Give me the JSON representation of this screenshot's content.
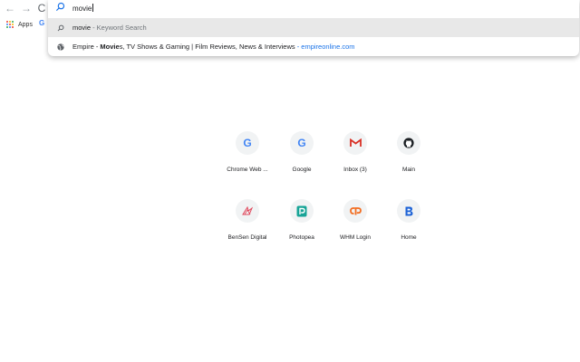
{
  "browser": {
    "nav": {
      "back": "←",
      "forward": "→",
      "reload": "C"
    },
    "bookmarks": {
      "apps_label": "Apps",
      "google_glyph": "G"
    }
  },
  "omnibox": {
    "query": "movie",
    "suggestions": [
      {
        "icon": "search-icon",
        "bold": "movie",
        "rest": " - Keyword Search",
        "url": ""
      },
      {
        "icon": "globe-icon",
        "pre": "Empire - ",
        "bold": "Movie",
        "rest": "s, TV Shows & Gaming | Film Reviews, News & Interviews",
        "url": " - empireonline.com"
      }
    ]
  },
  "colors": {
    "google_blue": "#4285f4",
    "google_red": "#ea4335",
    "google_yellow": "#fbbc05",
    "google_green": "#34a853",
    "gmail_red": "#d93025",
    "url_blue": "#1a73e8",
    "bensen_red": "#e0485c",
    "photopea_teal": "#18a497",
    "whm_orange": "#f26d21",
    "home_blue": "#1e63d6"
  },
  "shortcuts": [
    {
      "label": "Chrome Web ...",
      "icon": "google-g-icon"
    },
    {
      "label": "Google",
      "icon": "google-g-icon"
    },
    {
      "label": "Inbox (3)",
      "icon": "gmail-icon"
    },
    {
      "label": "Main",
      "icon": "github-icon"
    },
    {
      "label": "BenSen Digital",
      "icon": "bensen-logo-icon"
    },
    {
      "label": "Photopea",
      "icon": "photopea-icon"
    },
    {
      "label": "WHM Login",
      "icon": "cpanel-icon"
    },
    {
      "label": "Home",
      "icon": "home-b-icon"
    }
  ]
}
